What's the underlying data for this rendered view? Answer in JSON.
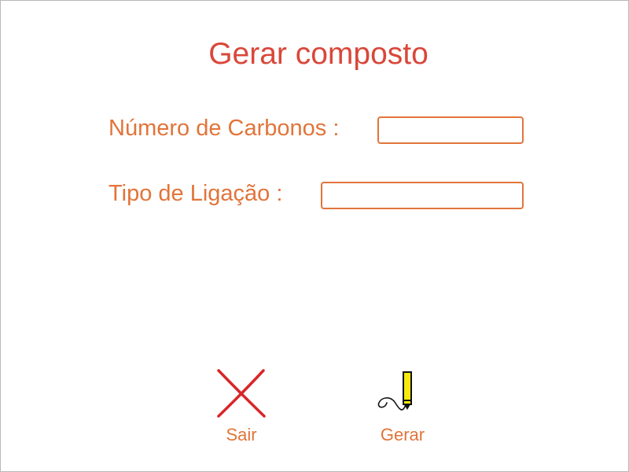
{
  "dialog": {
    "title": "Gerar composto",
    "fields": {
      "carbonos": {
        "label": "Número de Carbonos :",
        "value": ""
      },
      "ligacao": {
        "label": "Tipo de Ligação :",
        "value": ""
      }
    },
    "actions": {
      "sair": {
        "label": "Sair",
        "icon": "close-x-icon"
      },
      "gerar": {
        "label": "Gerar",
        "icon": "marker-pen-icon"
      }
    }
  },
  "colors": {
    "title": "#d9473a",
    "label": "#e2743a",
    "field_border": "#e2743a",
    "close_icon": "#d8262a",
    "marker_body": "#f5e90f"
  }
}
